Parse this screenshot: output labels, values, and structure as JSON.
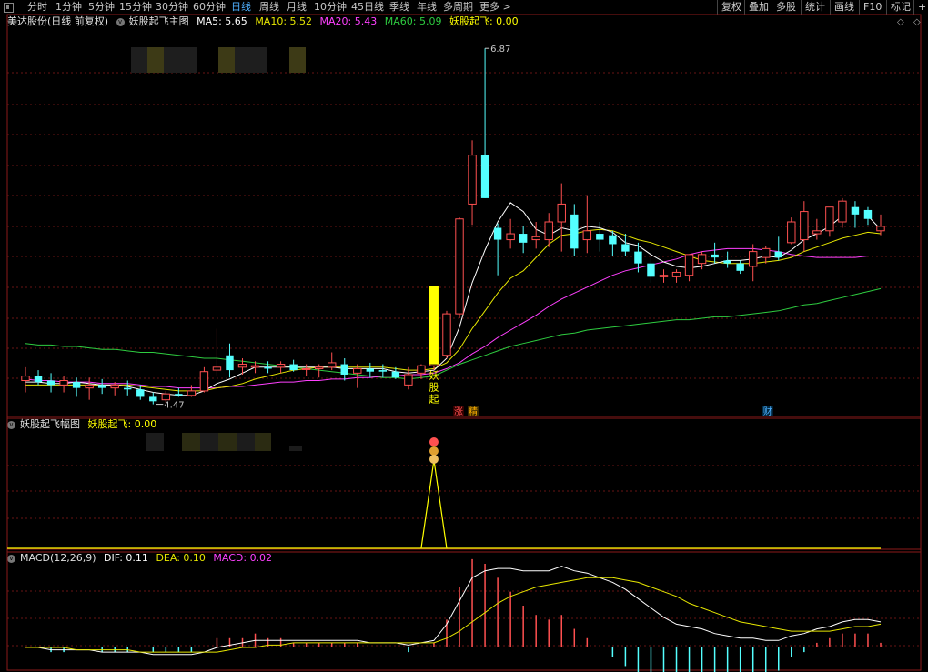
{
  "toolbar": {
    "tabs": [
      "分时",
      "1分钟",
      "5分钟",
      "15分钟",
      "30分钟",
      "60分钟",
      "日线",
      "周线",
      "月线",
      "10分钟",
      "45日线",
      "季线",
      "年线",
      "多周期",
      "更多 >"
    ],
    "active_tab": "日线",
    "right_buttons": [
      "复权",
      "叠加",
      "多股",
      "统计",
      "画线",
      "F10",
      "标记",
      "+自"
    ]
  },
  "main_panel": {
    "stock_name": "美达股份(日线 前复权)",
    "indicator": "妖股起飞主图",
    "ma5": "MA5: 5.65",
    "ma10": "MA10: 5.52",
    "ma20": "MA20: 5.43",
    "ma60": "MA60: 5.09",
    "signal": "妖股起飞: 0.00",
    "high_label": "6.87",
    "low_label": "4.47",
    "signal_text": "妖股起",
    "tag_zhang": "涨",
    "tag_jing": "精",
    "tag_cai": "财"
  },
  "mid_panel": {
    "title": "妖股起飞幅图",
    "value": "妖股起飞: 0.00"
  },
  "macd_panel": {
    "title": "MACD(12,26,9)",
    "dif": "DIF: 0.11",
    "dea": "DEA: 0.10",
    "macd": "MACD: 0.02"
  },
  "colors": {
    "up": "#ff5050",
    "down": "#54ffff",
    "ma5": "#ffffff",
    "ma10": "#e6e600",
    "ma20": "#ff40ff",
    "ma60": "#2ecc40",
    "signal": "#ffff00",
    "grid": "#8b1a1a"
  },
  "chart_data": {
    "type": "candlestick",
    "ohlc": [
      [
        4.63,
        4.72,
        4.55,
        4.66
      ],
      [
        4.66,
        4.7,
        4.6,
        4.62
      ],
      [
        4.63,
        4.68,
        4.55,
        4.6
      ],
      [
        4.6,
        4.66,
        4.55,
        4.63
      ],
      [
        4.62,
        4.65,
        4.52,
        4.58
      ],
      [
        4.58,
        4.65,
        4.5,
        4.6
      ],
      [
        4.6,
        4.64,
        4.54,
        4.58
      ],
      [
        4.58,
        4.62,
        4.53,
        4.6
      ],
      [
        4.58,
        4.63,
        4.53,
        4.57
      ],
      [
        4.57,
        4.6,
        4.5,
        4.52
      ],
      [
        4.52,
        4.55,
        4.47,
        4.49
      ],
      [
        4.5,
        4.56,
        4.48,
        4.54
      ],
      [
        4.54,
        4.58,
        4.52,
        4.53
      ],
      [
        4.53,
        4.6,
        4.52,
        4.56
      ],
      [
        4.56,
        4.72,
        4.55,
        4.69
      ],
      [
        4.7,
        4.98,
        4.66,
        4.72
      ],
      [
        4.8,
        4.88,
        4.65,
        4.7
      ],
      [
        4.72,
        4.78,
        4.67,
        4.74
      ],
      [
        4.72,
        4.76,
        4.68,
        4.73
      ],
      [
        4.72,
        4.76,
        4.68,
        4.71
      ],
      [
        4.72,
        4.76,
        4.68,
        4.74
      ],
      [
        4.74,
        4.77,
        4.69,
        4.7
      ],
      [
        4.71,
        4.74,
        4.66,
        4.71
      ],
      [
        4.71,
        4.74,
        4.65,
        4.72
      ],
      [
        4.72,
        4.82,
        4.7,
        4.75
      ],
      [
        4.74,
        4.78,
        4.63,
        4.67
      ],
      [
        4.68,
        4.74,
        4.58,
        4.71
      ],
      [
        4.71,
        4.75,
        4.65,
        4.69
      ],
      [
        4.7,
        4.74,
        4.65,
        4.69
      ],
      [
        4.69,
        4.72,
        4.64,
        4.65
      ],
      [
        4.6,
        4.72,
        4.57,
        4.67
      ],
      [
        4.68,
        4.74,
        4.64,
        4.73
      ],
      [
        4.73,
        4.78,
        4.7,
        4.76
      ],
      [
        4.8,
        5.1,
        4.78,
        5.08
      ],
      [
        5.08,
        5.73,
        5.05,
        5.72
      ],
      [
        5.82,
        6.25,
        5.68,
        6.15
      ],
      [
        6.15,
        6.87,
        5.86,
        5.86
      ],
      [
        5.66,
        5.69,
        5.34,
        5.58
      ],
      [
        5.58,
        5.72,
        5.52,
        5.62
      ],
      [
        5.62,
        5.67,
        5.49,
        5.56
      ],
      [
        5.58,
        5.7,
        5.52,
        5.6
      ],
      [
        5.58,
        5.76,
        5.53,
        5.7
      ],
      [
        5.7,
        5.96,
        5.5,
        5.82
      ],
      [
        5.75,
        5.82,
        5.47,
        5.52
      ],
      [
        5.58,
        5.88,
        5.49,
        5.64
      ],
      [
        5.62,
        5.7,
        5.5,
        5.58
      ],
      [
        5.61,
        5.64,
        5.47,
        5.55
      ],
      [
        5.55,
        5.62,
        5.47,
        5.5
      ],
      [
        5.5,
        5.56,
        5.36,
        5.42
      ],
      [
        5.42,
        5.46,
        5.29,
        5.33
      ],
      [
        5.33,
        5.38,
        5.29,
        5.34
      ],
      [
        5.33,
        5.38,
        5.29,
        5.36
      ],
      [
        5.34,
        5.45,
        5.3,
        5.48
      ],
      [
        5.42,
        5.5,
        5.38,
        5.48
      ],
      [
        5.48,
        5.56,
        5.42,
        5.46
      ],
      [
        5.44,
        5.5,
        5.39,
        5.42
      ],
      [
        5.42,
        5.44,
        5.35,
        5.37
      ],
      [
        5.4,
        5.55,
        5.3,
        5.5
      ],
      [
        5.46,
        5.54,
        5.42,
        5.52
      ],
      [
        5.5,
        5.6,
        5.44,
        5.46
      ],
      [
        5.56,
        5.73,
        5.55,
        5.7
      ],
      [
        5.58,
        5.84,
        5.5,
        5.77
      ],
      [
        5.62,
        5.72,
        5.58,
        5.64
      ],
      [
        5.64,
        5.8,
        5.6,
        5.8
      ],
      [
        5.7,
        5.86,
        5.66,
        5.84
      ],
      [
        5.8,
        5.84,
        5.66,
        5.75
      ],
      [
        5.78,
        5.8,
        5.68,
        5.72
      ],
      [
        5.64,
        5.75,
        5.61,
        5.67
      ]
    ],
    "ma5": [
      4.62,
      4.62,
      4.61,
      4.61,
      4.62,
      4.61,
      4.6,
      4.6,
      4.59,
      4.57,
      4.55,
      4.54,
      4.53,
      4.53,
      4.56,
      4.61,
      4.64,
      4.68,
      4.72,
      4.72,
      4.72,
      4.72,
      4.72,
      4.72,
      4.72,
      4.71,
      4.71,
      4.71,
      4.71,
      4.69,
      4.68,
      4.69,
      4.7,
      4.78,
      4.99,
      5.29,
      5.51,
      5.7,
      5.83,
      5.77,
      5.65,
      5.61,
      5.66,
      5.64,
      5.67,
      5.66,
      5.63,
      5.56,
      5.54,
      5.48,
      5.43,
      5.4,
      5.39,
      5.4,
      5.42,
      5.44,
      5.44,
      5.45,
      5.47,
      5.46,
      5.51,
      5.58,
      5.62,
      5.67,
      5.74,
      5.74,
      5.74,
      5.65
    ],
    "ma10": [
      4.6,
      4.6,
      4.6,
      4.6,
      4.6,
      4.6,
      4.6,
      4.6,
      4.6,
      4.59,
      4.58,
      4.57,
      4.56,
      4.56,
      4.56,
      4.58,
      4.59,
      4.61,
      4.64,
      4.66,
      4.68,
      4.7,
      4.71,
      4.72,
      4.72,
      4.72,
      4.72,
      4.72,
      4.72,
      4.71,
      4.7,
      4.7,
      4.71,
      4.75,
      4.84,
      4.98,
      5.1,
      5.22,
      5.32,
      5.37,
      5.46,
      5.55,
      5.61,
      5.62,
      5.64,
      5.65,
      5.64,
      5.61,
      5.58,
      5.56,
      5.53,
      5.5,
      5.47,
      5.44,
      5.43,
      5.42,
      5.42,
      5.42,
      5.43,
      5.44,
      5.46,
      5.5,
      5.53,
      5.56,
      5.59,
      5.61,
      5.63,
      5.62
    ],
    "ma20": [
      4.64,
      4.63,
      4.63,
      4.62,
      4.62,
      4.62,
      4.61,
      4.61,
      4.61,
      4.6,
      4.59,
      4.59,
      4.58,
      4.58,
      4.58,
      4.58,
      4.59,
      4.59,
      4.6,
      4.61,
      4.62,
      4.62,
      4.63,
      4.63,
      4.64,
      4.64,
      4.65,
      4.65,
      4.66,
      4.66,
      4.67,
      4.67,
      4.68,
      4.71,
      4.75,
      4.81,
      4.86,
      4.92,
      4.97,
      5.02,
      5.07,
      5.13,
      5.18,
      5.22,
      5.26,
      5.3,
      5.34,
      5.37,
      5.39,
      5.41,
      5.43,
      5.45,
      5.48,
      5.5,
      5.51,
      5.52,
      5.52,
      5.52,
      5.51,
      5.5,
      5.48,
      5.47,
      5.46,
      5.46,
      5.46,
      5.46,
      5.47,
      5.47
    ],
    "ma60": [
      4.88,
      4.87,
      4.87,
      4.86,
      4.86,
      4.85,
      4.84,
      4.84,
      4.83,
      4.82,
      4.82,
      4.81,
      4.8,
      4.79,
      4.78,
      4.78,
      4.77,
      4.76,
      4.75,
      4.74,
      4.73,
      4.72,
      4.71,
      4.7,
      4.69,
      4.68,
      4.67,
      4.66,
      4.65,
      4.65,
      4.64,
      4.65,
      4.66,
      4.7,
      4.74,
      4.77,
      4.8,
      4.83,
      4.86,
      4.88,
      4.9,
      4.92,
      4.94,
      4.95,
      4.97,
      4.98,
      4.99,
      5.0,
      5.01,
      5.02,
      5.03,
      5.04,
      5.04,
      5.05,
      5.06,
      5.06,
      5.07,
      5.08,
      5.09,
      5.1,
      5.12,
      5.14,
      5.15,
      5.17,
      5.19,
      5.21,
      5.23,
      5.25
    ],
    "signal_bar_index": 32,
    "signal_bar_range": [
      4.74,
      5.27
    ],
    "price_range": [
      4.4,
      7.0
    ],
    "signal_series_spike_index": 32,
    "macd_dif": [
      0.0,
      0.0,
      -0.01,
      -0.01,
      -0.01,
      -0.01,
      -0.02,
      -0.02,
      -0.02,
      -0.02,
      -0.03,
      -0.03,
      -0.03,
      -0.03,
      -0.02,
      0.0,
      0.01,
      0.02,
      0.03,
      0.03,
      0.03,
      0.03,
      0.03,
      0.03,
      0.03,
      0.03,
      0.03,
      0.02,
      0.02,
      0.02,
      0.01,
      0.02,
      0.03,
      0.1,
      0.2,
      0.3,
      0.33,
      0.34,
      0.34,
      0.33,
      0.33,
      0.33,
      0.35,
      0.33,
      0.32,
      0.3,
      0.28,
      0.25,
      0.21,
      0.17,
      0.13,
      0.1,
      0.09,
      0.08,
      0.06,
      0.05,
      0.04,
      0.04,
      0.03,
      0.03,
      0.05,
      0.06,
      0.08,
      0.09,
      0.11,
      0.12,
      0.12,
      0.11
    ],
    "macd_dea": [
      0.0,
      0.0,
      0.0,
      0.0,
      -0.01,
      -0.01,
      -0.01,
      -0.01,
      -0.01,
      -0.02,
      -0.02,
      -0.02,
      -0.02,
      -0.02,
      -0.02,
      -0.02,
      -0.01,
      0.0,
      0.0,
      0.01,
      0.01,
      0.02,
      0.02,
      0.02,
      0.02,
      0.02,
      0.02,
      0.02,
      0.02,
      0.02,
      0.02,
      0.02,
      0.02,
      0.04,
      0.07,
      0.11,
      0.15,
      0.19,
      0.22,
      0.24,
      0.26,
      0.27,
      0.28,
      0.29,
      0.3,
      0.3,
      0.3,
      0.29,
      0.28,
      0.26,
      0.24,
      0.22,
      0.19,
      0.17,
      0.15,
      0.13,
      0.11,
      0.1,
      0.09,
      0.08,
      0.07,
      0.07,
      0.07,
      0.07,
      0.08,
      0.09,
      0.09,
      0.1
    ],
    "macd_range": [
      -0.09,
      0.36
    ]
  }
}
